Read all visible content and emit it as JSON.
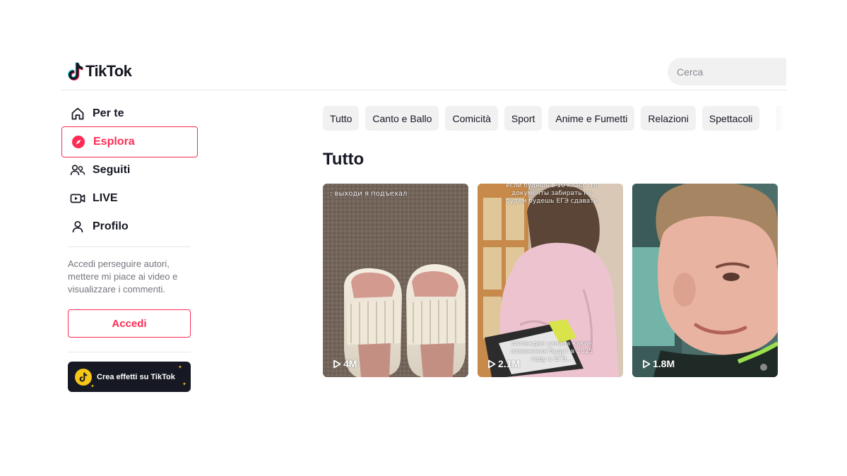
{
  "header": {
    "logo_text": "TikTok",
    "search_placeholder": "Cerca"
  },
  "sidebar": {
    "items": [
      {
        "label": "Per te",
        "icon": "home-icon",
        "active": false
      },
      {
        "label": "Esplora",
        "icon": "compass-icon",
        "active": true
      },
      {
        "label": "Seguiti",
        "icon": "following-icon",
        "active": false
      },
      {
        "label": "LIVE",
        "icon": "live-icon",
        "active": false
      },
      {
        "label": "Profilo",
        "icon": "profile-icon",
        "active": false
      }
    ],
    "login_prompt": "Accedi perseguire autori, mettere mi piace ai video e visualizzare i commenti.",
    "login_button": "Accedi",
    "effects_button": "Crea effetti su TikTok"
  },
  "categories": [
    "Tutto",
    "Canto e Ballo",
    "Comicità",
    "Sport",
    "Anime e Fumetti",
    "Relazioni",
    "Spettacoli"
  ],
  "section_title": "Tutto",
  "videos": [
    {
      "views": "4M",
      "caption": ": выходи я подъехал"
    },
    {
      "views": "2.1M",
      "caption_top": "если будешь в 10 класс, то документы забирать не будем будешь ЕГЭ сдавать",
      "caption_bottom": "оплаждая узнала какие изменения будут в 2025 году в ЕГЭ..."
    },
    {
      "views": "1.8M"
    }
  ],
  "colors": {
    "accent": "#fe2c55",
    "text": "#161823",
    "muted": "#73757d",
    "chip_bg": "#f1f1f2"
  }
}
